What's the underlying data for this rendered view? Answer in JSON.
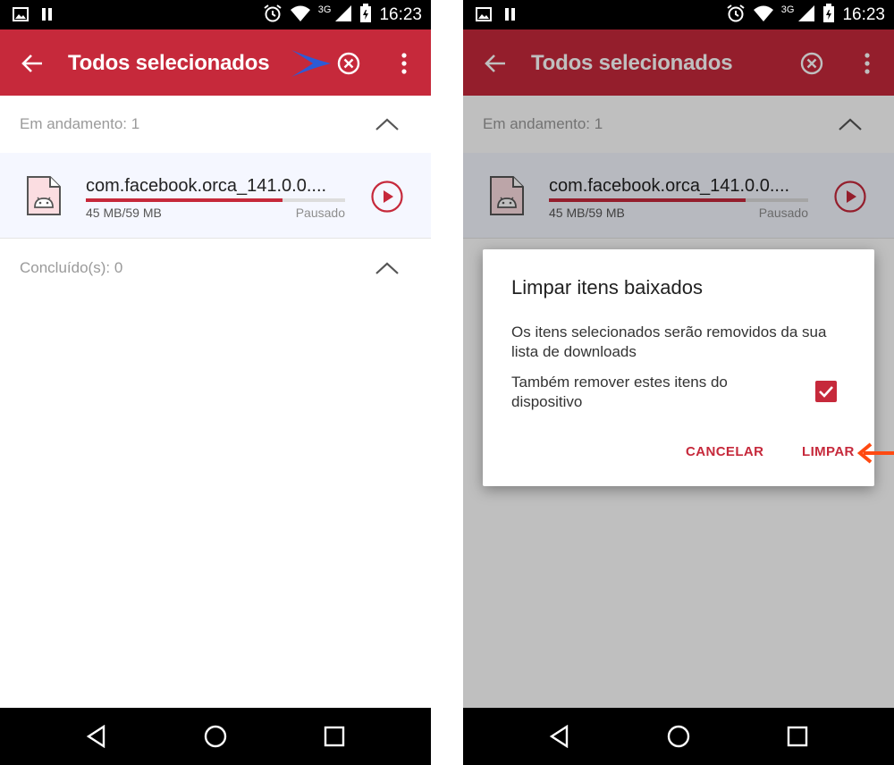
{
  "colors": {
    "accent": "#c6293b",
    "statusbar": "#000000",
    "navbar": "#000000",
    "annotation_arrow_blue": "#2d5bd6",
    "annotation_arrow_orange": "#ff4a12"
  },
  "status_bar": {
    "time": "16:23",
    "network": "3G",
    "icons": [
      "image-icon",
      "pause-icon",
      "alarm-icon",
      "wifi-icon",
      "signal-icon",
      "battery-icon"
    ]
  },
  "app_bar": {
    "title": "Todos selecionados",
    "icons": [
      "back-arrow-icon",
      "clear-circle-x-icon",
      "more-vert-icon"
    ]
  },
  "sections": {
    "in_progress": "Em andamento: 1",
    "completed": "Concluído(s): 0"
  },
  "download": {
    "file_name": "com.facebook.orca_141.0.0....",
    "size": "45 MB/59 MB",
    "status": "Pausado",
    "progress": 0.76,
    "icon": "android-apk-file-icon",
    "action_icon": "play-icon"
  },
  "dialog": {
    "title": "Limpar itens baixados",
    "message": "Os itens selecionados serão removidos da sua lista de downloads",
    "checkbox_label": "Também remover estes itens do dispositivo",
    "checkbox_checked": true,
    "cancel": "CANCELAR",
    "confirm": "LIMPAR"
  },
  "nav": {
    "icons": [
      "back-triangle-icon",
      "home-circle-icon",
      "recents-square-icon"
    ]
  }
}
